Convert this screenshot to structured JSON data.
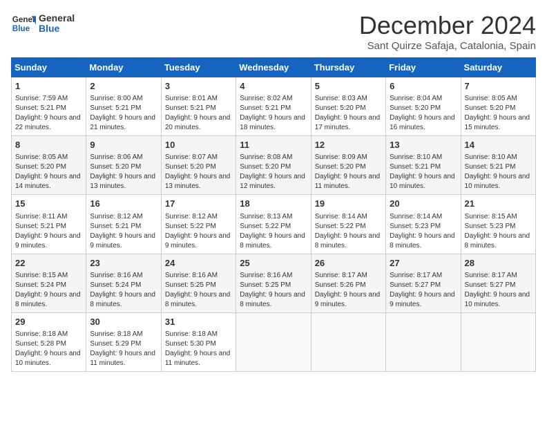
{
  "header": {
    "logo_line1": "General",
    "logo_line2": "Blue",
    "month_title": "December 2024",
    "location": "Sant Quirze Safaja, Catalonia, Spain"
  },
  "days_of_week": [
    "Sunday",
    "Monday",
    "Tuesday",
    "Wednesday",
    "Thursday",
    "Friday",
    "Saturday"
  ],
  "weeks": [
    [
      {
        "day": "1",
        "sunrise": "7:59 AM",
        "sunset": "5:21 PM",
        "daylight": "9 hours and 22 minutes."
      },
      {
        "day": "2",
        "sunrise": "8:00 AM",
        "sunset": "5:21 PM",
        "daylight": "9 hours and 21 minutes."
      },
      {
        "day": "3",
        "sunrise": "8:01 AM",
        "sunset": "5:21 PM",
        "daylight": "9 hours and 20 minutes."
      },
      {
        "day": "4",
        "sunrise": "8:02 AM",
        "sunset": "5:21 PM",
        "daylight": "9 hours and 18 minutes."
      },
      {
        "day": "5",
        "sunrise": "8:03 AM",
        "sunset": "5:20 PM",
        "daylight": "9 hours and 17 minutes."
      },
      {
        "day": "6",
        "sunrise": "8:04 AM",
        "sunset": "5:20 PM",
        "daylight": "9 hours and 16 minutes."
      },
      {
        "day": "7",
        "sunrise": "8:05 AM",
        "sunset": "5:20 PM",
        "daylight": "9 hours and 15 minutes."
      }
    ],
    [
      {
        "day": "8",
        "sunrise": "8:05 AM",
        "sunset": "5:20 PM",
        "daylight": "9 hours and 14 minutes."
      },
      {
        "day": "9",
        "sunrise": "8:06 AM",
        "sunset": "5:20 PM",
        "daylight": "9 hours and 13 minutes."
      },
      {
        "day": "10",
        "sunrise": "8:07 AM",
        "sunset": "5:20 PM",
        "daylight": "9 hours and 13 minutes."
      },
      {
        "day": "11",
        "sunrise": "8:08 AM",
        "sunset": "5:20 PM",
        "daylight": "9 hours and 12 minutes."
      },
      {
        "day": "12",
        "sunrise": "8:09 AM",
        "sunset": "5:20 PM",
        "daylight": "9 hours and 11 minutes."
      },
      {
        "day": "13",
        "sunrise": "8:10 AM",
        "sunset": "5:21 PM",
        "daylight": "9 hours and 10 minutes."
      },
      {
        "day": "14",
        "sunrise": "8:10 AM",
        "sunset": "5:21 PM",
        "daylight": "9 hours and 10 minutes."
      }
    ],
    [
      {
        "day": "15",
        "sunrise": "8:11 AM",
        "sunset": "5:21 PM",
        "daylight": "9 hours and 9 minutes."
      },
      {
        "day": "16",
        "sunrise": "8:12 AM",
        "sunset": "5:21 PM",
        "daylight": "9 hours and 9 minutes."
      },
      {
        "day": "17",
        "sunrise": "8:12 AM",
        "sunset": "5:22 PM",
        "daylight": "9 hours and 9 minutes."
      },
      {
        "day": "18",
        "sunrise": "8:13 AM",
        "sunset": "5:22 PM",
        "daylight": "9 hours and 8 minutes."
      },
      {
        "day": "19",
        "sunrise": "8:14 AM",
        "sunset": "5:22 PM",
        "daylight": "9 hours and 8 minutes."
      },
      {
        "day": "20",
        "sunrise": "8:14 AM",
        "sunset": "5:23 PM",
        "daylight": "9 hours and 8 minutes."
      },
      {
        "day": "21",
        "sunrise": "8:15 AM",
        "sunset": "5:23 PM",
        "daylight": "9 hours and 8 minutes."
      }
    ],
    [
      {
        "day": "22",
        "sunrise": "8:15 AM",
        "sunset": "5:24 PM",
        "daylight": "9 hours and 8 minutes."
      },
      {
        "day": "23",
        "sunrise": "8:16 AM",
        "sunset": "5:24 PM",
        "daylight": "9 hours and 8 minutes."
      },
      {
        "day": "24",
        "sunrise": "8:16 AM",
        "sunset": "5:25 PM",
        "daylight": "9 hours and 8 minutes."
      },
      {
        "day": "25",
        "sunrise": "8:16 AM",
        "sunset": "5:25 PM",
        "daylight": "9 hours and 8 minutes."
      },
      {
        "day": "26",
        "sunrise": "8:17 AM",
        "sunset": "5:26 PM",
        "daylight": "9 hours and 9 minutes."
      },
      {
        "day": "27",
        "sunrise": "8:17 AM",
        "sunset": "5:27 PM",
        "daylight": "9 hours and 9 minutes."
      },
      {
        "day": "28",
        "sunrise": "8:17 AM",
        "sunset": "5:27 PM",
        "daylight": "9 hours and 10 minutes."
      }
    ],
    [
      {
        "day": "29",
        "sunrise": "8:18 AM",
        "sunset": "5:28 PM",
        "daylight": "9 hours and 10 minutes."
      },
      {
        "day": "30",
        "sunrise": "8:18 AM",
        "sunset": "5:29 PM",
        "daylight": "9 hours and 11 minutes."
      },
      {
        "day": "31",
        "sunrise": "8:18 AM",
        "sunset": "5:30 PM",
        "daylight": "9 hours and 11 minutes."
      },
      null,
      null,
      null,
      null
    ]
  ],
  "labels": {
    "sunrise": "Sunrise: ",
    "sunset": "Sunset: ",
    "daylight": "Daylight: "
  }
}
